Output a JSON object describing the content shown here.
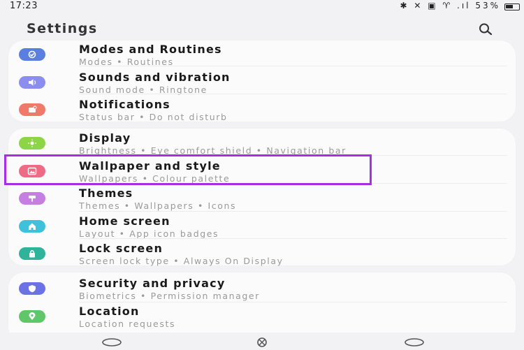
{
  "status_bar": {
    "time": "17:23",
    "icons": "✱ ✕ ▣ ♈ .ıl",
    "battery_text": "53%"
  },
  "header": {
    "title": "Settings",
    "search_icon": "search-icon"
  },
  "groups": [
    {
      "items": [
        {
          "title": "Modes and Routines",
          "subtitle": "Modes  •  Routines",
          "icon": "check-circle-icon",
          "color": "#5b7fe0"
        },
        {
          "title": "Sounds and vibration",
          "subtitle": "Sound mode  •  Ringtone",
          "icon": "speaker-icon",
          "color": "#8b8ef0"
        },
        {
          "title": "Notifications",
          "subtitle": "Status bar  •  Do not disturb",
          "icon": "notification-icon",
          "color": "#f07a6a"
        }
      ]
    },
    {
      "items": [
        {
          "title": "Display",
          "subtitle": "Brightness  •  Eye comfort shield  •  Navigation bar",
          "icon": "sun-icon",
          "color": "#8ed447"
        },
        {
          "title": "Wallpaper and style",
          "subtitle": "Wallpapers  •  Colour palette",
          "icon": "image-icon",
          "color": "#ee6b86"
        },
        {
          "title": "Themes",
          "subtitle": "Themes  •  Wallpapers  •  Icons",
          "icon": "theme-brush-icon",
          "color": "#c57fe0"
        },
        {
          "title": "Home screen",
          "subtitle": "Layout  •  App icon badges",
          "icon": "home-icon",
          "color": "#3fc1dc"
        },
        {
          "title": "Lock screen",
          "subtitle": "Screen lock type  •  Always On Display",
          "icon": "lock-icon",
          "color": "#2fb39a"
        }
      ]
    },
    {
      "items": [
        {
          "title": "Security and privacy",
          "subtitle": "Biometrics  •  Permission manager",
          "icon": "shield-icon",
          "color": "#6b72e6"
        },
        {
          "title": "Location",
          "subtitle": "Location requests",
          "icon": "location-icon",
          "color": "#5fc76a"
        }
      ]
    }
  ],
  "highlight": {
    "target": "Wallpaper and style",
    "color": "#a72ee2"
  },
  "nav_bar": {
    "buttons": [
      "recents-icon",
      "home-nav-icon",
      "back-icon"
    ]
  }
}
